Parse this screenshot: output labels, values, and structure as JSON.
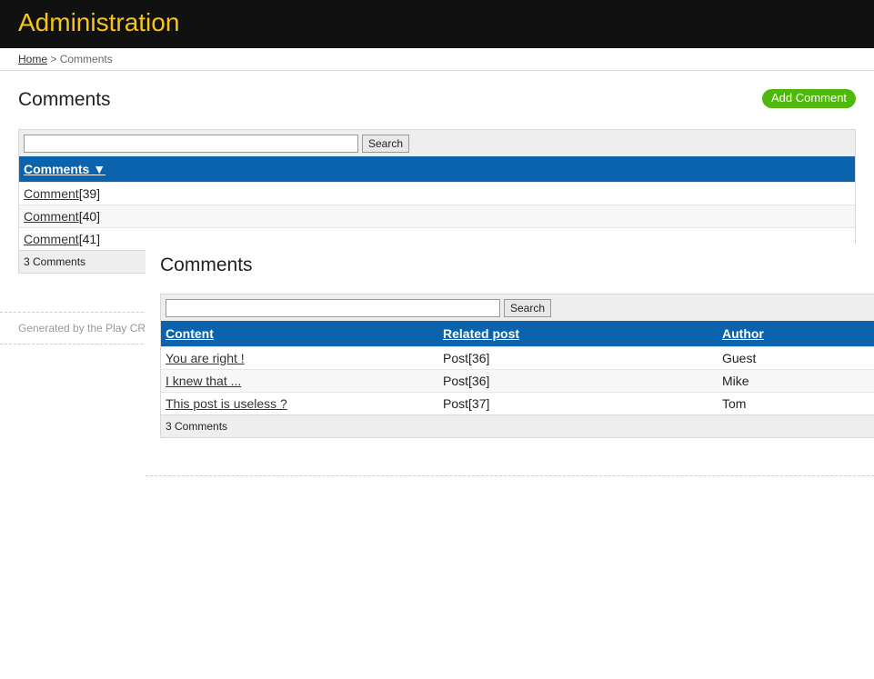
{
  "header": {
    "title": "Administration"
  },
  "breadcrumb": {
    "home": "Home",
    "separator": ">",
    "current": "Comments"
  },
  "page": {
    "title": "Comments",
    "add_button": "Add Comment"
  },
  "list_panel": {
    "search_placeholder": "",
    "search_button": "Search",
    "column": "Comments ▼",
    "rows": [
      {
        "link": "Comment",
        "id": "[39]"
      },
      {
        "link": "Comment",
        "id": "[40]"
      },
      {
        "link": "Comment",
        "id": "[41]"
      }
    ],
    "count": "3 Comments"
  },
  "footer": {
    "generated": "Generated by the Play CR"
  },
  "overlay": {
    "title": "Comments",
    "search_placeholder": "",
    "search_button": "Search",
    "columns": {
      "content": "Content",
      "related": "Related post",
      "author": "Author"
    },
    "rows": [
      {
        "content": "You are right !",
        "related": "Post[36]",
        "author": "Guest"
      },
      {
        "content": "I knew that ...",
        "related": "Post[36]",
        "author": "Mike"
      },
      {
        "content": "This post is useless ?",
        "related": "Post[37]",
        "author": "Tom"
      }
    ],
    "count": "3 Comments"
  },
  "colors": {
    "header_bg": "#111111",
    "header_title": "#f5c518",
    "table_header": "#0b63ad",
    "add_button": "#4eb80c"
  }
}
